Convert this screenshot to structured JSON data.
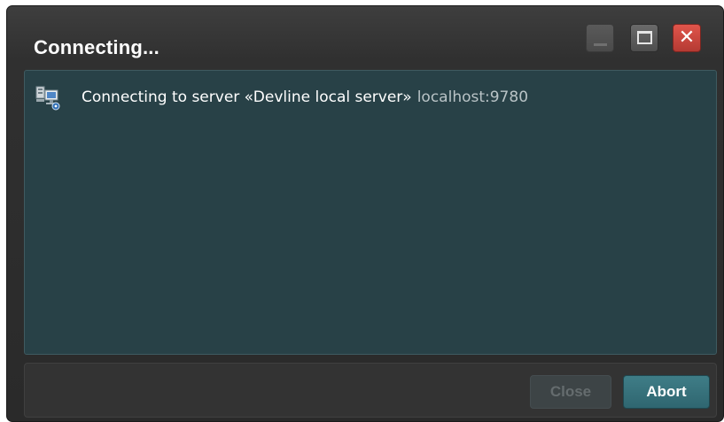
{
  "window": {
    "title": "Connecting..."
  },
  "titlebar_buttons": {
    "minimize_icon": "minimize-icon",
    "maximize_icon": "maximize-icon",
    "close_icon": "close-icon",
    "close_glyph": "✕",
    "close_color": "#c9443b"
  },
  "status": {
    "icon": "network-server-icon",
    "message": "Connecting to server «Devline local server»",
    "host": "localhost:9780"
  },
  "footer": {
    "close_label": "Close",
    "close_enabled": false,
    "abort_label": "Abort",
    "abort_color": "#357380"
  },
  "colors": {
    "content_bg": "#284147",
    "window_bg": "#303030"
  }
}
